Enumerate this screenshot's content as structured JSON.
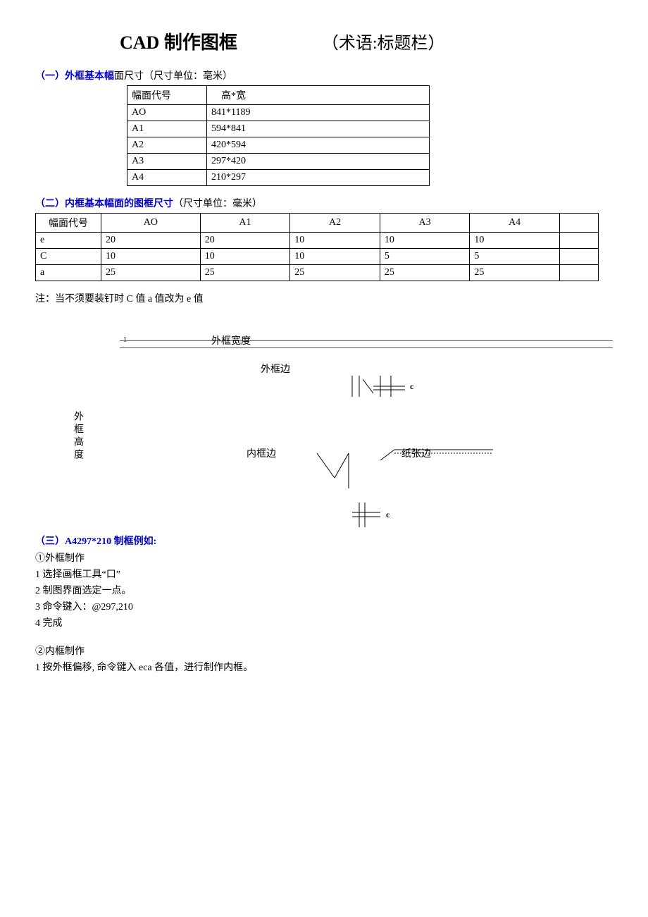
{
  "title": {
    "main": "CAD 制作图框",
    "sub": "（术语:标题栏）"
  },
  "section1": {
    "head_blue": "（一）外框基本幅",
    "head_black": "面尺寸（尺寸单位：毫米）"
  },
  "table1": {
    "h1": "幅面代号",
    "h2": "高*宽",
    "rows": [
      {
        "code": "AO",
        "size": "841*1189"
      },
      {
        "code": "A1",
        "size": "594*841"
      },
      {
        "code": "A2",
        "size": "420*594"
      },
      {
        "code": "A3",
        "size": "297*420"
      },
      {
        "code": "A4",
        "size": "210*297"
      }
    ]
  },
  "section2": {
    "head_blue": "（二）内框基本幅面的图框尺寸",
    "head_black": "（尺寸单位：毫米）"
  },
  "table2": {
    "head": [
      "幅面代号",
      "AO",
      "A1",
      "A2",
      "A3",
      "A4",
      ""
    ],
    "rows": [
      [
        "e",
        "20",
        "20",
        "10",
        "10",
        "10",
        ""
      ],
      [
        "C",
        "10",
        "10",
        "10",
        "5",
        "5",
        ""
      ],
      [
        "a",
        "25",
        "25",
        "25",
        "25",
        "25",
        ""
      ]
    ]
  },
  "note": "注：当不须要装钉时 C 值 a 值改为 e 值",
  "diagram": {
    "outer_width": "外框宽度",
    "outer_side": "外框边",
    "outer_height": "外框高度",
    "inner_side": "内框边",
    "paper_side": "纸张边",
    "c1": "c",
    "c2": "c",
    "one": "1"
  },
  "section3": {
    "head_blue": "（三）A4297*210 制框例如:"
  },
  "steps": {
    "s0": "①外框制作",
    "s1": "1 选择画框工具“口”",
    "s2": "2 制图界面选定一点。",
    "s3": "3 命令键入：@297,210",
    "s4": "4 完成",
    "blank": "",
    "s5": "②内框制作",
    "s6": "1 按外框偏移, 命令键入 eca 各值，进行制作内框。"
  }
}
